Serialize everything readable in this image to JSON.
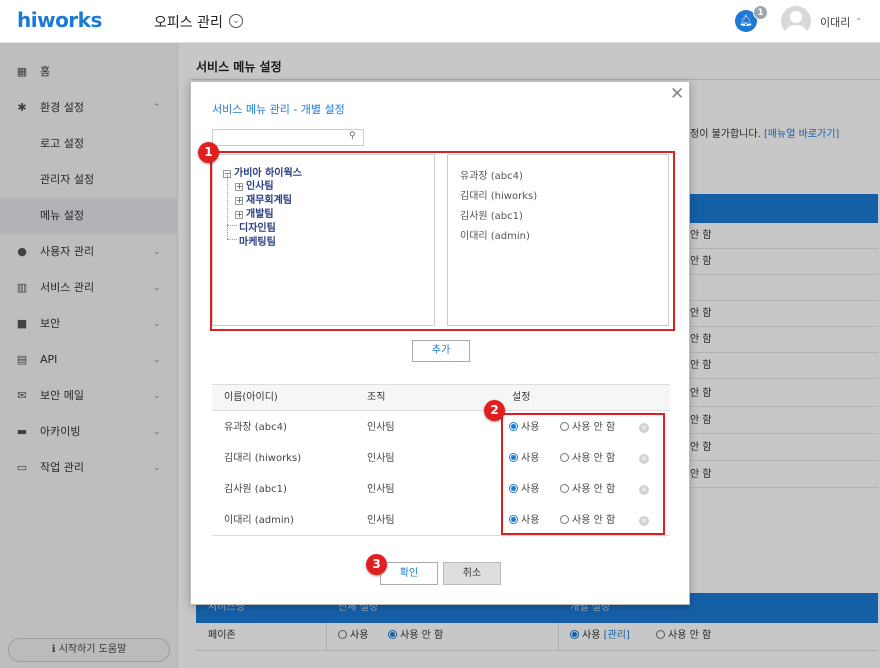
{
  "header": {
    "logo": "hiworks",
    "office_title": "오피스 관리",
    "notification_count": "1",
    "user_name": "이대리"
  },
  "sidebar": {
    "items": [
      {
        "icon": "building-icon",
        "label": "홈"
      },
      {
        "icon": "gear-icon",
        "label": "환경 설정",
        "expanded": true
      },
      {
        "icon": "person-icon",
        "label": "사용자 관리"
      },
      {
        "icon": "chart-icon",
        "label": "서비스 관리"
      },
      {
        "icon": "lock-icon",
        "label": "보안"
      },
      {
        "icon": "api-icon",
        "label": "API"
      },
      {
        "icon": "mail-icon",
        "label": "보안 메일"
      },
      {
        "icon": "archive-icon",
        "label": "아카이빙"
      },
      {
        "icon": "monitor-icon",
        "label": "작업 관리"
      }
    ],
    "sub_items": [
      "로고 설정",
      "관리자 설정",
      "메뉴 설정"
    ],
    "active_sub": "메뉴 설정",
    "help_button": "시작하기 도움말"
  },
  "main": {
    "title": "서비스 메뉴 설정",
    "notice_tail": "정이 불가합니다.",
    "notice_link": "[매뉴얼 바로가기]",
    "bg_rows": [
      "안 함",
      "안 함",
      "",
      "안 함",
      "안 함",
      "안 함",
      "안 함",
      "안 함",
      "안 함",
      "안 함"
    ],
    "bottom_header": [
      "서비스명",
      "전체 설정",
      "개별 설정"
    ],
    "bottom_row": {
      "service": "페이존",
      "all_use": "사용",
      "all_nouse": "사용 안 함",
      "ind_use": "사용",
      "ind_link": "[관리]",
      "ind_nouse": "사용 안 함"
    }
  },
  "modal": {
    "title": "서비스 메뉴 관리 - 개별 설정",
    "search_placeholder": "",
    "tree": {
      "root": "가비아 하이웍스",
      "children": [
        "인사팀",
        "재무회계팀",
        "개발팀",
        "디자인팀",
        "마케팅팀"
      ]
    },
    "users": [
      "유과장 (abc4)",
      "김대리 (hiworks)",
      "김사원 (abc1)",
      "이대리 (admin)"
    ],
    "add_button": "추가",
    "table": {
      "headers": [
        "이름(아이디)",
        "조직",
        "설정"
      ],
      "rows": [
        {
          "name": "유과장 (abc4)",
          "org": "인사팀",
          "use": "사용",
          "nouse": "사용 안 함",
          "selected": "use"
        },
        {
          "name": "김대리 (hiworks)",
          "org": "인사팀",
          "use": "사용",
          "nouse": "사용 안 함",
          "selected": "use"
        },
        {
          "name": "김사원 (abc1)",
          "org": "인사팀",
          "use": "사용",
          "nouse": "사용 안 함",
          "selected": "use"
        },
        {
          "name": "이대리 (admin)",
          "org": "인사팀",
          "use": "사용",
          "nouse": "사용 안 함",
          "selected": "use"
        }
      ]
    },
    "ok_button": "확인",
    "cancel_button": "취소",
    "markers": [
      "1",
      "2",
      "3"
    ]
  },
  "colors": {
    "brand": "#1c7ad6",
    "marker_red": "#e02020"
  }
}
